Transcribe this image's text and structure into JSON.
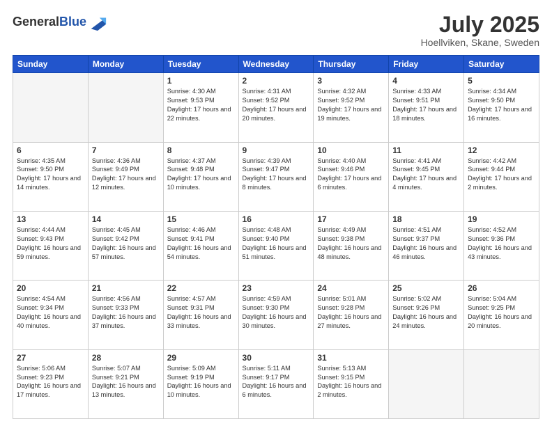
{
  "header": {
    "logo_general": "General",
    "logo_blue": "Blue",
    "month_title": "July 2025",
    "location": "Hoellviken, Skane, Sweden"
  },
  "days_of_week": [
    "Sunday",
    "Monday",
    "Tuesday",
    "Wednesday",
    "Thursday",
    "Friday",
    "Saturday"
  ],
  "weeks": [
    [
      {
        "day": "",
        "sunrise": "",
        "sunset": "",
        "daylight": ""
      },
      {
        "day": "",
        "sunrise": "",
        "sunset": "",
        "daylight": ""
      },
      {
        "day": "1",
        "sunrise": "Sunrise: 4:30 AM",
        "sunset": "Sunset: 9:53 PM",
        "daylight": "Daylight: 17 hours and 22 minutes."
      },
      {
        "day": "2",
        "sunrise": "Sunrise: 4:31 AM",
        "sunset": "Sunset: 9:52 PM",
        "daylight": "Daylight: 17 hours and 20 minutes."
      },
      {
        "day": "3",
        "sunrise": "Sunrise: 4:32 AM",
        "sunset": "Sunset: 9:52 PM",
        "daylight": "Daylight: 17 hours and 19 minutes."
      },
      {
        "day": "4",
        "sunrise": "Sunrise: 4:33 AM",
        "sunset": "Sunset: 9:51 PM",
        "daylight": "Daylight: 17 hours and 18 minutes."
      },
      {
        "day": "5",
        "sunrise": "Sunrise: 4:34 AM",
        "sunset": "Sunset: 9:50 PM",
        "daylight": "Daylight: 17 hours and 16 minutes."
      }
    ],
    [
      {
        "day": "6",
        "sunrise": "Sunrise: 4:35 AM",
        "sunset": "Sunset: 9:50 PM",
        "daylight": "Daylight: 17 hours and 14 minutes."
      },
      {
        "day": "7",
        "sunrise": "Sunrise: 4:36 AM",
        "sunset": "Sunset: 9:49 PM",
        "daylight": "Daylight: 17 hours and 12 minutes."
      },
      {
        "day": "8",
        "sunrise": "Sunrise: 4:37 AM",
        "sunset": "Sunset: 9:48 PM",
        "daylight": "Daylight: 17 hours and 10 minutes."
      },
      {
        "day": "9",
        "sunrise": "Sunrise: 4:39 AM",
        "sunset": "Sunset: 9:47 PM",
        "daylight": "Daylight: 17 hours and 8 minutes."
      },
      {
        "day": "10",
        "sunrise": "Sunrise: 4:40 AM",
        "sunset": "Sunset: 9:46 PM",
        "daylight": "Daylight: 17 hours and 6 minutes."
      },
      {
        "day": "11",
        "sunrise": "Sunrise: 4:41 AM",
        "sunset": "Sunset: 9:45 PM",
        "daylight": "Daylight: 17 hours and 4 minutes."
      },
      {
        "day": "12",
        "sunrise": "Sunrise: 4:42 AM",
        "sunset": "Sunset: 9:44 PM",
        "daylight": "Daylight: 17 hours and 2 minutes."
      }
    ],
    [
      {
        "day": "13",
        "sunrise": "Sunrise: 4:44 AM",
        "sunset": "Sunset: 9:43 PM",
        "daylight": "Daylight: 16 hours and 59 minutes."
      },
      {
        "day": "14",
        "sunrise": "Sunrise: 4:45 AM",
        "sunset": "Sunset: 9:42 PM",
        "daylight": "Daylight: 16 hours and 57 minutes."
      },
      {
        "day": "15",
        "sunrise": "Sunrise: 4:46 AM",
        "sunset": "Sunset: 9:41 PM",
        "daylight": "Daylight: 16 hours and 54 minutes."
      },
      {
        "day": "16",
        "sunrise": "Sunrise: 4:48 AM",
        "sunset": "Sunset: 9:40 PM",
        "daylight": "Daylight: 16 hours and 51 minutes."
      },
      {
        "day": "17",
        "sunrise": "Sunrise: 4:49 AM",
        "sunset": "Sunset: 9:38 PM",
        "daylight": "Daylight: 16 hours and 48 minutes."
      },
      {
        "day": "18",
        "sunrise": "Sunrise: 4:51 AM",
        "sunset": "Sunset: 9:37 PM",
        "daylight": "Daylight: 16 hours and 46 minutes."
      },
      {
        "day": "19",
        "sunrise": "Sunrise: 4:52 AM",
        "sunset": "Sunset: 9:36 PM",
        "daylight": "Daylight: 16 hours and 43 minutes."
      }
    ],
    [
      {
        "day": "20",
        "sunrise": "Sunrise: 4:54 AM",
        "sunset": "Sunset: 9:34 PM",
        "daylight": "Daylight: 16 hours and 40 minutes."
      },
      {
        "day": "21",
        "sunrise": "Sunrise: 4:56 AM",
        "sunset": "Sunset: 9:33 PM",
        "daylight": "Daylight: 16 hours and 37 minutes."
      },
      {
        "day": "22",
        "sunrise": "Sunrise: 4:57 AM",
        "sunset": "Sunset: 9:31 PM",
        "daylight": "Daylight: 16 hours and 33 minutes."
      },
      {
        "day": "23",
        "sunrise": "Sunrise: 4:59 AM",
        "sunset": "Sunset: 9:30 PM",
        "daylight": "Daylight: 16 hours and 30 minutes."
      },
      {
        "day": "24",
        "sunrise": "Sunrise: 5:01 AM",
        "sunset": "Sunset: 9:28 PM",
        "daylight": "Daylight: 16 hours and 27 minutes."
      },
      {
        "day": "25",
        "sunrise": "Sunrise: 5:02 AM",
        "sunset": "Sunset: 9:26 PM",
        "daylight": "Daylight: 16 hours and 24 minutes."
      },
      {
        "day": "26",
        "sunrise": "Sunrise: 5:04 AM",
        "sunset": "Sunset: 9:25 PM",
        "daylight": "Daylight: 16 hours and 20 minutes."
      }
    ],
    [
      {
        "day": "27",
        "sunrise": "Sunrise: 5:06 AM",
        "sunset": "Sunset: 9:23 PM",
        "daylight": "Daylight: 16 hours and 17 minutes."
      },
      {
        "day": "28",
        "sunrise": "Sunrise: 5:07 AM",
        "sunset": "Sunset: 9:21 PM",
        "daylight": "Daylight: 16 hours and 13 minutes."
      },
      {
        "day": "29",
        "sunrise": "Sunrise: 5:09 AM",
        "sunset": "Sunset: 9:19 PM",
        "daylight": "Daylight: 16 hours and 10 minutes."
      },
      {
        "day": "30",
        "sunrise": "Sunrise: 5:11 AM",
        "sunset": "Sunset: 9:17 PM",
        "daylight": "Daylight: 16 hours and 6 minutes."
      },
      {
        "day": "31",
        "sunrise": "Sunrise: 5:13 AM",
        "sunset": "Sunset: 9:15 PM",
        "daylight": "Daylight: 16 hours and 2 minutes."
      },
      {
        "day": "",
        "sunrise": "",
        "sunset": "",
        "daylight": ""
      },
      {
        "day": "",
        "sunrise": "",
        "sunset": "",
        "daylight": ""
      }
    ]
  ]
}
